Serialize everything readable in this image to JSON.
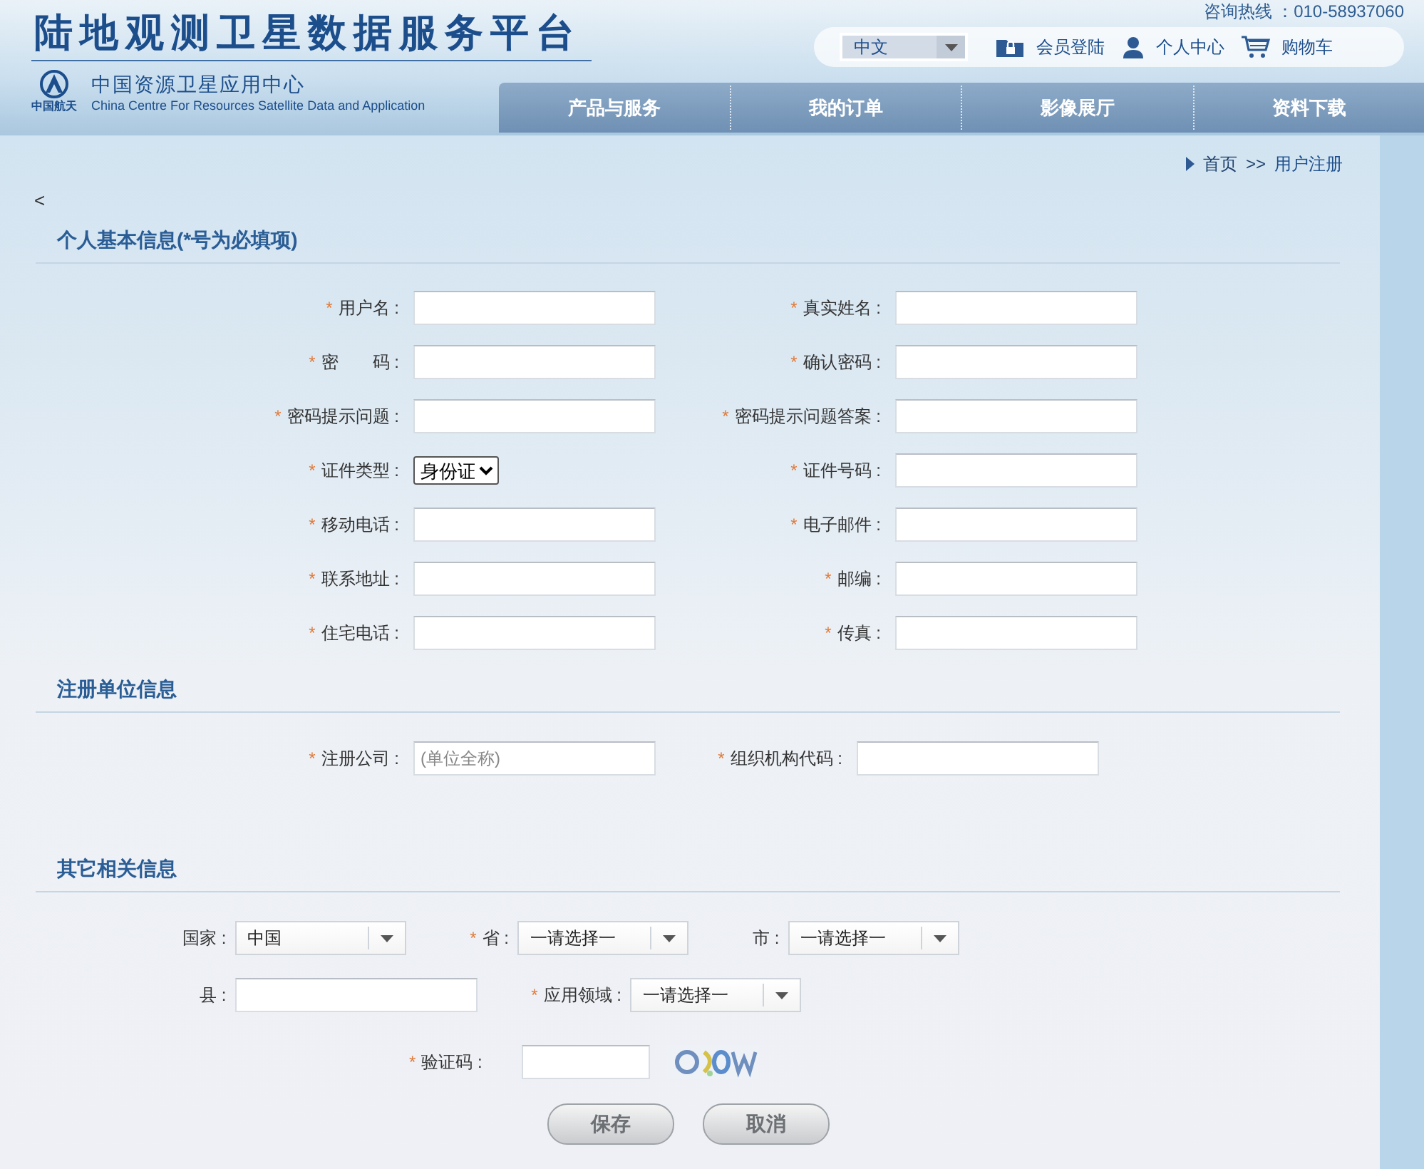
{
  "header": {
    "title": "陆地观测卫星数据服务平台",
    "logo_caption": "中国航天",
    "org_name": "中国资源卫星应用中心",
    "org_name_en": "China Centre For Resources Satellite Data and Application",
    "hotline": "咨询热线 ：010-58937060",
    "language": "中文",
    "user_links": [
      {
        "label": "会员登陆",
        "kind": "login"
      },
      {
        "label": "个人中心",
        "kind": "user"
      },
      {
        "label": "购物车",
        "kind": "cart"
      }
    ],
    "nav": [
      "产品与服务",
      "我的订单",
      "影像展厅",
      "资料下载"
    ]
  },
  "breadcrumb": {
    "items": [
      "首页",
      "用户注册"
    ],
    "separator": ">>"
  },
  "back": "<",
  "required_mark": "*",
  "personal_info": {
    "title": "个人基本信息(*号为必填项)",
    "fields": [
      {
        "label": "用户名 :",
        "required": true,
        "kind": "input"
      },
      {
        "label": "真实姓名 :",
        "required": true,
        "kind": "input"
      },
      {
        "label": "密　　码 :",
        "required": true,
        "kind": "input"
      },
      {
        "label": "确认密码 :",
        "required": true,
        "kind": "input"
      },
      {
        "label": "密码提示问题 :",
        "required": true,
        "kind": "input"
      },
      {
        "label": "密码提示问题答案 :",
        "required": true,
        "kind": "input"
      },
      {
        "label": "证件类型 :",
        "required": true,
        "kind": "select",
        "value": "身份证"
      },
      {
        "label": "证件号码 :",
        "required": true,
        "kind": "input"
      },
      {
        "label": "移动电话 :",
        "required": true,
        "kind": "input"
      },
      {
        "label": "电子邮件 :",
        "required": true,
        "kind": "input"
      },
      {
        "label": "联系地址 :",
        "required": true,
        "kind": "input"
      },
      {
        "label": "邮编 :",
        "required": true,
        "kind": "input"
      },
      {
        "label": "住宅电话 :",
        "required": true,
        "kind": "input"
      },
      {
        "label": "传真 :",
        "required": true,
        "kind": "input"
      }
    ]
  },
  "company_info": {
    "title": "注册单位信息",
    "fields": [
      {
        "label": "注册公司 :",
        "required": true,
        "kind": "input",
        "placeholder": "(单位全称)"
      },
      {
        "label": "组织机构代码 :",
        "required": true,
        "kind": "input"
      }
    ]
  },
  "other_info": {
    "title": "其它相关信息",
    "rows": [
      [
        {
          "label": "国家 :",
          "required": false,
          "kind": "combo",
          "value": "中国"
        },
        {
          "label": "省 :",
          "required": true,
          "kind": "combo",
          "value": "一请选择一"
        },
        {
          "label": "市 :",
          "required": false,
          "kind": "combo",
          "value": "一请选择一"
        }
      ],
      [
        {
          "label": "县 :",
          "required": false,
          "kind": "input"
        },
        {
          "label": "应用领域 :",
          "required": true,
          "kind": "combo",
          "value": "一请选择一"
        }
      ],
      [
        {
          "label": "验证码 :",
          "required": true,
          "kind": "captcha"
        }
      ]
    ]
  },
  "buttons": [
    "保存",
    "取消"
  ]
}
